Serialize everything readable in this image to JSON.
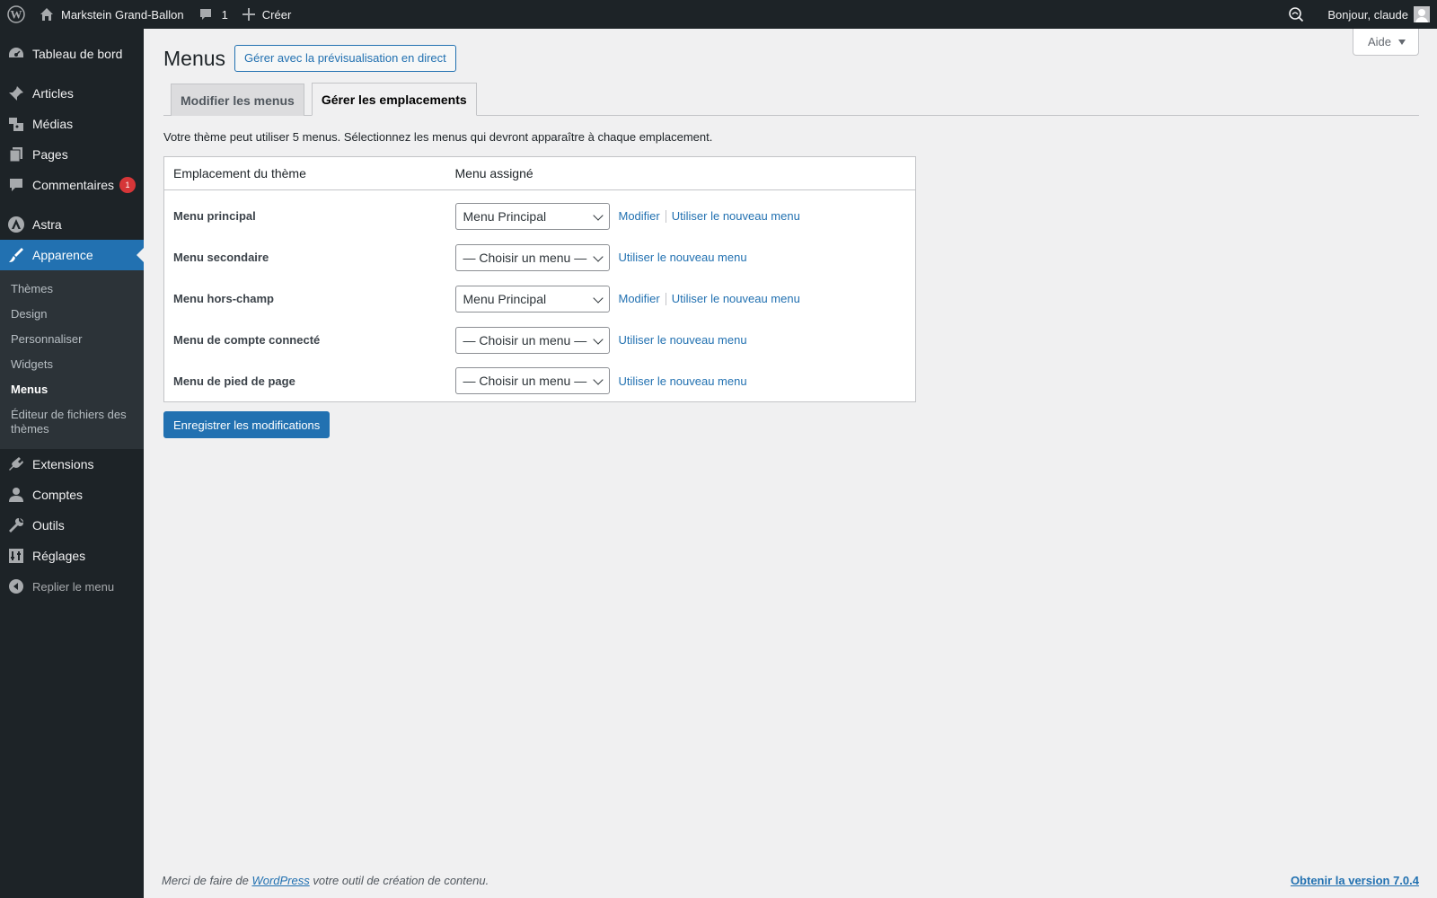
{
  "adminbar": {
    "site_name": "Markstein Grand-Ballon",
    "comments_count": "1",
    "new_label": "Créer",
    "greeting": "Bonjour, claude"
  },
  "sidebar": {
    "items": [
      {
        "label": "Tableau de bord",
        "icon": "dashboard-icon"
      },
      {
        "label": "Articles",
        "icon": "pin-icon"
      },
      {
        "label": "Médias",
        "icon": "media-icon"
      },
      {
        "label": "Pages",
        "icon": "pages-icon"
      },
      {
        "label": "Commentaires",
        "icon": "comment-icon",
        "badge": "1"
      },
      {
        "label": "Astra",
        "icon": "astra-icon"
      },
      {
        "label": "Apparence",
        "icon": "brush-icon"
      },
      {
        "label": "Extensions",
        "icon": "plugin-icon"
      },
      {
        "label": "Comptes",
        "icon": "user-icon"
      },
      {
        "label": "Outils",
        "icon": "wrench-icon"
      },
      {
        "label": "Réglages",
        "icon": "settings-icon"
      }
    ],
    "submenu": [
      "Thèmes",
      "Design",
      "Personnaliser",
      "Widgets",
      "Menus",
      "Éditeur de fichiers des thèmes"
    ],
    "collapse_label": "Replier le menu"
  },
  "help_tab": "Aide",
  "page": {
    "title": "Menus",
    "action_button": "Gérer avec la prévisualisation en direct",
    "tabs": [
      "Modifier les menus",
      "Gérer les emplacements"
    ],
    "description": "Votre thème peut utiliser 5 menus. Sélectionnez les menus qui devront apparaître à chaque emplacement.",
    "table_headers": [
      "Emplacement du thème",
      "Menu assigné"
    ],
    "locations": [
      {
        "name": "Menu principal",
        "selected": "Menu Principal",
        "edit": "Modifier",
        "new": "Utiliser le nouveau menu"
      },
      {
        "name": "Menu secondaire",
        "selected": "— Choisir un menu —",
        "edit": "",
        "new": "Utiliser le nouveau menu"
      },
      {
        "name": "Menu hors-champ",
        "selected": "Menu Principal",
        "edit": "Modifier",
        "new": "Utiliser le nouveau menu"
      },
      {
        "name": "Menu de compte connecté",
        "selected": "— Choisir un menu —",
        "edit": "",
        "new": "Utiliser le nouveau menu"
      },
      {
        "name": "Menu de pied de page",
        "selected": "— Choisir un menu —",
        "edit": "",
        "new": "Utiliser le nouveau menu"
      }
    ],
    "save_button": "Enregistrer les modifications"
  },
  "footer": {
    "thanks_before": "Merci de faire de ",
    "thanks_link": "WordPress",
    "thanks_after": " votre outil de création de contenu.",
    "upgrade": "Obtenir la version 7.0.4"
  }
}
